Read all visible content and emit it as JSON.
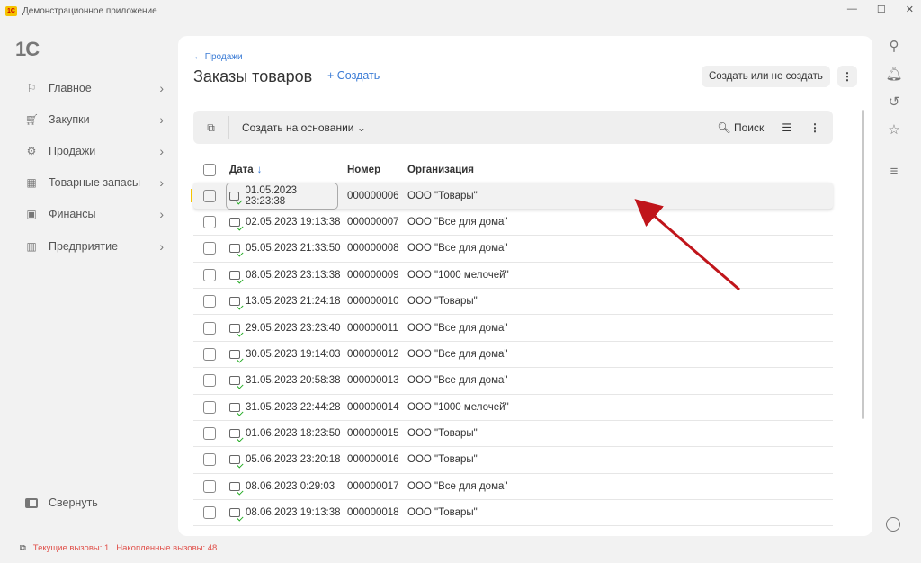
{
  "window": {
    "title": "Демонстрационное приложение",
    "logo": "1С"
  },
  "brand": "1С",
  "nav": [
    {
      "label": "Главное",
      "icon": "flag-icon"
    },
    {
      "label": "Закупки",
      "icon": "cart-icon"
    },
    {
      "label": "Продажи",
      "icon": "sales-icon"
    },
    {
      "label": "Товарные запасы",
      "icon": "warehouse-icon"
    },
    {
      "label": "Финансы",
      "icon": "wallet-icon"
    },
    {
      "label": "Предприятие",
      "icon": "chart-icon"
    }
  ],
  "collapse_label": "Свернуть",
  "status": {
    "current": "Текущие вызовы: 1",
    "accumulated": "Накопленные вызовы: 48"
  },
  "page": {
    "back": "← Продажи",
    "title": "Заказы товаров",
    "create": "+ Создать",
    "option_button": "Создать или не создать"
  },
  "toolbar": {
    "create_based": "Создать на основании ⌄",
    "search": "Поиск"
  },
  "table": {
    "headers": {
      "date": "Дата",
      "number": "Номер",
      "org": "Организация"
    },
    "rows": [
      {
        "date": "01.05.2023 23:23:38",
        "number": "000000006",
        "org": "ООО \"Товары\""
      },
      {
        "date": "02.05.2023 19:13:38",
        "number": "000000007",
        "org": "ООО \"Все для дома\""
      },
      {
        "date": "05.05.2023 21:33:50",
        "number": "000000008",
        "org": "ООО \"Все для дома\""
      },
      {
        "date": "08.05.2023 23:13:38",
        "number": "000000009",
        "org": "ООО \"1000 мелочей\""
      },
      {
        "date": "13.05.2023 21:24:18",
        "number": "000000010",
        "org": "ООО \"Товары\""
      },
      {
        "date": "29.05.2023 23:23:40",
        "number": "000000011",
        "org": "ООО \"Все для дома\""
      },
      {
        "date": "30.05.2023 19:14:03",
        "number": "000000012",
        "org": "ООО \"Все для дома\""
      },
      {
        "date": "31.05.2023 20:58:38",
        "number": "000000013",
        "org": "ООО \"Все для дома\""
      },
      {
        "date": "31.05.2023 22:44:28",
        "number": "000000014",
        "org": "ООО \"1000 мелочей\""
      },
      {
        "date": "01.06.2023 18:23:50",
        "number": "000000015",
        "org": "ООО \"Товары\""
      },
      {
        "date": "05.06.2023 23:20:18",
        "number": "000000016",
        "org": "ООО \"Товары\""
      },
      {
        "date": "08.06.2023 0:29:03",
        "number": "000000017",
        "org": "ООО \"Все для дома\""
      },
      {
        "date": "08.06.2023 19:13:38",
        "number": "000000018",
        "org": "ООО \"Товары\""
      }
    ]
  },
  "colors": {
    "accent": "#3a7bd5",
    "annotation": "#c0151b",
    "status": "#e0504a"
  }
}
